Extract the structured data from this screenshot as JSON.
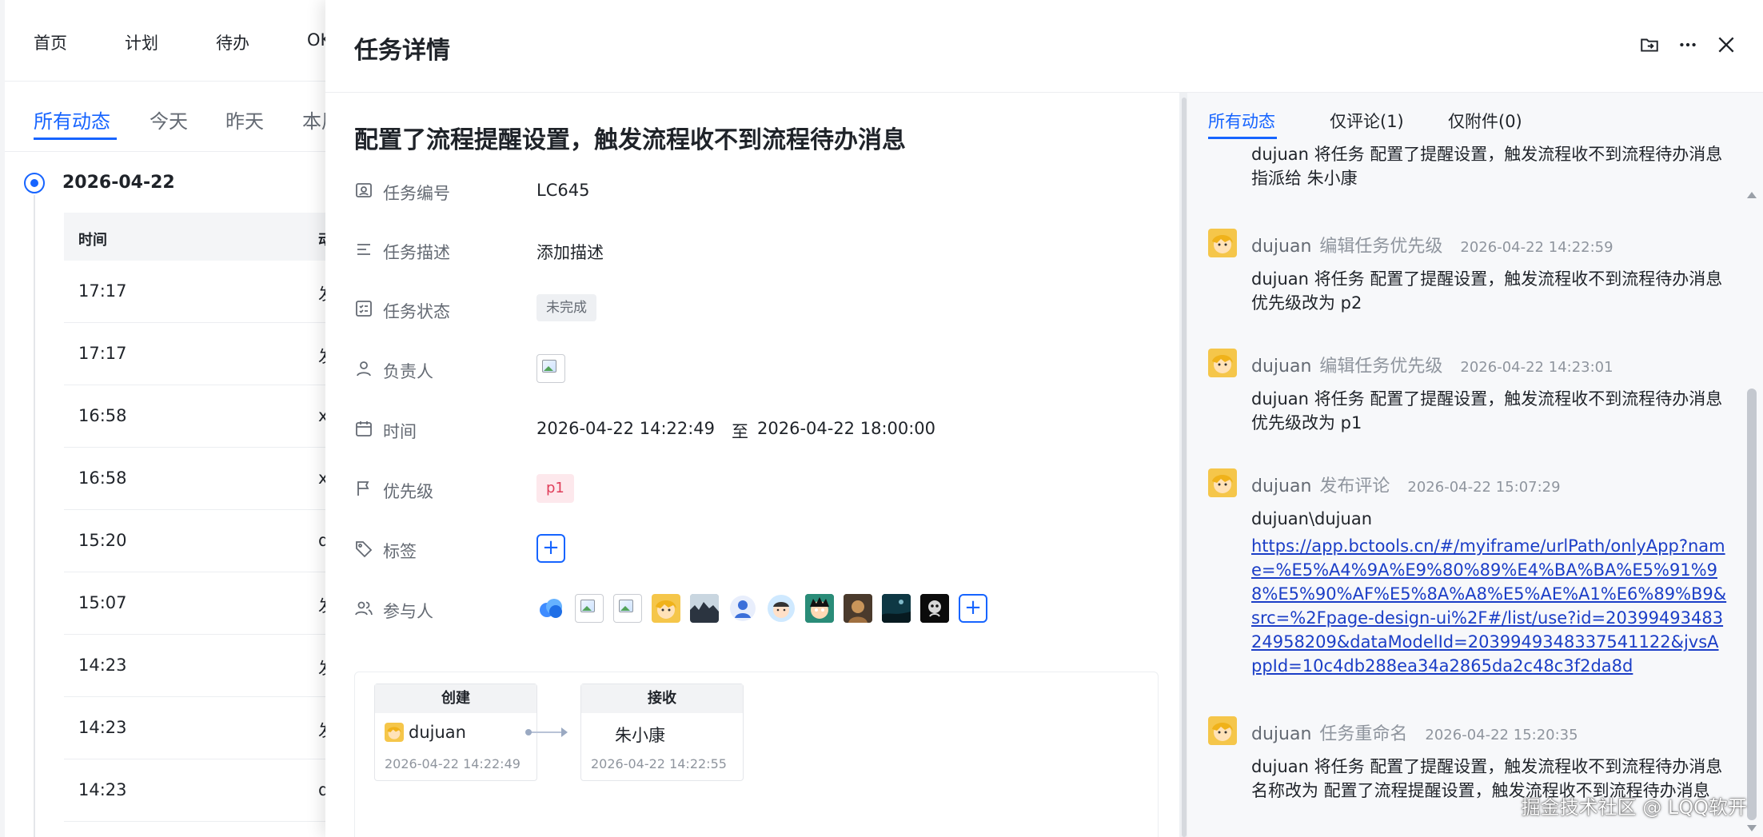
{
  "background": {
    "nav": [
      "首页",
      "计划",
      "待办",
      "OK"
    ],
    "tabs": [
      "所有动态",
      "今天",
      "昨天",
      "本周"
    ],
    "date": "2026-04-22",
    "table_headers": [
      "时间",
      "动态"
    ],
    "rows": [
      {
        "time": "17:17",
        "act": "发"
      },
      {
        "time": "17:17",
        "act": "发"
      },
      {
        "time": "16:58",
        "act": "x"
      },
      {
        "time": "16:58",
        "act": "x"
      },
      {
        "time": "15:20",
        "act": "d"
      },
      {
        "time": "15:07",
        "act": "发"
      },
      {
        "time": "14:23",
        "act": "发"
      },
      {
        "time": "14:23",
        "act": "发"
      },
      {
        "time": "14:23",
        "act": "d"
      }
    ]
  },
  "drawer": {
    "title": "任务详情",
    "task_title": "配置了流程提醒设置，触发流程收不到流程待办消息",
    "fields": {
      "number_label": "任务编号",
      "number_value": "LC645",
      "desc_label": "任务描述",
      "desc_value": "添加描述",
      "status_label": "任务状态",
      "status_value": "未完成",
      "owner_label": "负责人",
      "time_label": "时间",
      "time_start": "2026-04-22 14:22:49",
      "time_sep": "至",
      "time_end": "2026-04-22 18:00:00",
      "priority_label": "优先级",
      "priority_value": "p1",
      "tags_label": "标签",
      "participants_label": "参与人"
    },
    "flow": {
      "nodes": [
        {
          "head": "创建",
          "name": "dujuan",
          "time": "2026-04-22 14:22:49"
        },
        {
          "head": "接收",
          "name": "朱小康",
          "time": "2026-04-22 14:22:55"
        }
      ]
    }
  },
  "activity": {
    "tabs": [
      "所有动态",
      "仅评论(1)",
      "仅附件(0)"
    ],
    "items": [
      {
        "body": "dujuan 将任务 配置了提醒设置，触发流程收不到流程待办消息 指派给 朱小康"
      },
      {
        "user": "dujuan",
        "action": "编辑任务优先级",
        "time": "2026-04-22 14:22:59",
        "body": "dujuan 将任务 配置了提醒设置，触发流程收不到流程待办消息 优先级改为 p2"
      },
      {
        "user": "dujuan",
        "action": "编辑任务优先级",
        "time": "2026-04-22 14:23:01",
        "body": "dujuan 将任务 配置了提醒设置，触发流程收不到流程待办消息 优先级改为 p1"
      },
      {
        "user": "dujuan",
        "action": "发布评论",
        "time": "2026-04-22 15:07:29",
        "body": "dujuan\\dujuan",
        "link": "https://app.bctools.cn/#/myiframe/urlPath/onlyApp?name=%E5%A4%9A%E9%80%89%E4%BA%BA%E5%91%98%E5%90%AF%E5%8A%A8%E5%AE%A1%E6%89%B9&src=%2Fpage-design-ui%2F#/list/use?id=2039949348324958209&dataModelId=2039949348337541122&jvsAppId=10c4db288ea34a2865da2c48c3f2da8d"
      },
      {
        "user": "dujuan",
        "action": "任务重命名",
        "time": "2026-04-22 15:20:35",
        "body": "dujuan 将任务 配置了提醒设置，触发流程收不到流程待办消息 名称改为 配置了流程提醒设置，触发流程收不到流程待办消息"
      }
    ]
  },
  "watermark": "掘金技术社区 @ LQQ软开",
  "colors": {
    "accent": "#1664ff",
    "priority": "#e03e5a",
    "link": "#1b3ec7"
  }
}
